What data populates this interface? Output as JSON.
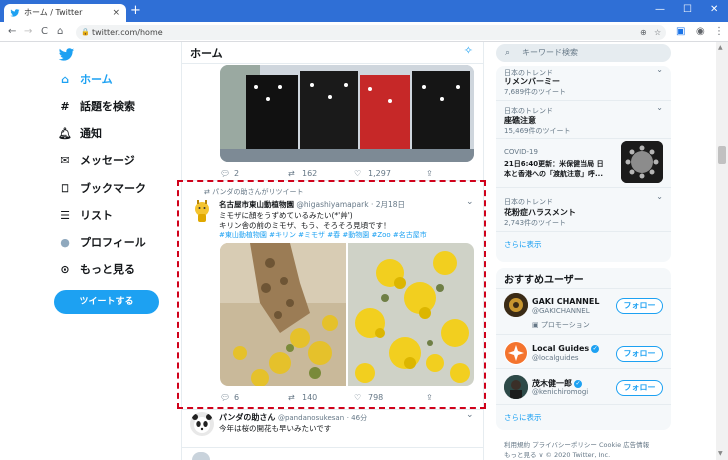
{
  "browser": {
    "tab_title": "ホーム / Twitter",
    "tab_close": "×",
    "new_tab": "+",
    "minimize": "—",
    "maximize": "☐",
    "close": "✕",
    "back": "←",
    "forward": "→",
    "reload": "C",
    "home": "⌂",
    "url": "twitter.com/home",
    "menu": "⋮"
  },
  "nav": {
    "items": [
      {
        "label": "ホーム",
        "icon": "home-icon",
        "glyph": "⌂"
      },
      {
        "label": "話題を検索",
        "icon": "hashtag-icon",
        "glyph": "#"
      },
      {
        "label": "通知",
        "icon": "bell-icon",
        "glyph": "♫"
      },
      {
        "label": "メッセージ",
        "icon": "envelope-icon",
        "glyph": "✉"
      },
      {
        "label": "ブックマーク",
        "icon": "bookmark-icon",
        "glyph": "⚑"
      },
      {
        "label": "リスト",
        "icon": "list-icon",
        "glyph": "☰"
      },
      {
        "label": "プロフィール",
        "icon": "profile-avatar-icon",
        "glyph": "●"
      },
      {
        "label": "もっと見る",
        "icon": "more-icon",
        "glyph": "⋯"
      }
    ],
    "tweet_button": "ツイートする"
  },
  "main": {
    "title": "ホーム",
    "sparkle": "✧",
    "first_tweet": {
      "replies": "2",
      "retweets": "162",
      "likes": "1,297"
    },
    "highlight_tweet": {
      "retweeted_by": "パンダの助さんがリツイート",
      "author": "名古屋市東山動植物園",
      "handle": "@higashiyamapark",
      "date": "2月18日",
      "text_line1": "ミモザに顔をうずめているみたい(*'艸')",
      "text_line2": "キリン舎の前のミモザ、もう、そろそろ見頃です！",
      "hashtags": "#東山動植物園 #キリン #ミモザ #春 #動物園 #Zoo #名古屋市",
      "replies": "6",
      "retweets": "140",
      "likes": "798"
    },
    "third_tweet": {
      "author": "パンダの助さん",
      "handle": "@pandanosukesan",
      "time": "46分",
      "text": "今年は桜の開花も早いみたいです"
    }
  },
  "right": {
    "search_placeholder": "キーワード検索",
    "trends": [
      {
        "cat": "日本のトレンド",
        "name": "リメンバーミー",
        "count": "7,689件のツイート"
      },
      {
        "cat": "日本のトレンド",
        "name": "座礁注意",
        "count": "15,469件のツイート"
      },
      {
        "cat": "COVID-19",
        "name": "21日6:40更新：米保健当局 日本と香港への「渡航注意」呼...",
        "count": ""
      },
      {
        "cat": "日本のトレンド",
        "name": "花粉症ハラスメント",
        "count": "2,743件のツイート"
      }
    ],
    "trends_more": "さらに表示",
    "who_title": "おすすめユーザー",
    "users": [
      {
        "name": "GAKI CHANNEL",
        "handle": "@GAKICHANNEL",
        "sub": "プロモーション"
      },
      {
        "name": "Local Guides",
        "handle": "@localguides",
        "sub": ""
      },
      {
        "name": "茂木健一郎",
        "handle": "@kenichiromogi",
        "sub": ""
      }
    ],
    "follow_label": "フォロー",
    "who_more": "さらに表示",
    "footer1": "利用規約 プライバシーポリシー Cookie 広告情報",
    "footer2": "もっと見る ∨ © 2020 Twitter, Inc."
  },
  "colors": {
    "accent": "#1da1f2",
    "highlight": "#d0021b"
  }
}
